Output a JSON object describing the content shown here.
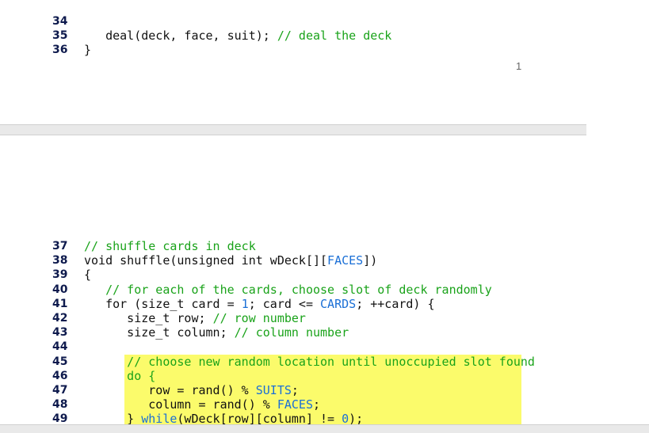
{
  "page1": {
    "page_number": "1",
    "lines": [
      {
        "num": "34",
        "code": "   deal(deck, face, suit); ",
        "comment": "// deal the deck"
      },
      {
        "num": "35",
        "code": "}",
        "comment": ""
      },
      {
        "num": "36",
        "code": "",
        "comment": ""
      }
    ]
  },
  "page2": {
    "lines": [
      {
        "num": "37",
        "segments": [
          {
            "t": "// shuffle cards in deck",
            "c": "cm"
          }
        ]
      },
      {
        "num": "38",
        "segments": [
          {
            "t": "void shuffle(unsigned int wDeck[][",
            "c": ""
          },
          {
            "t": "FACES",
            "c": "kw"
          },
          {
            "t": "])",
            "c": ""
          }
        ]
      },
      {
        "num": "39",
        "segments": [
          {
            "t": "{",
            "c": ""
          }
        ]
      },
      {
        "num": "40",
        "segments": [
          {
            "t": "   // for each of the cards, choose slot of deck randomly",
            "c": "cm"
          }
        ]
      },
      {
        "num": "41",
        "segments": [
          {
            "t": "   for (size_t card = ",
            "c": ""
          },
          {
            "t": "1",
            "c": "num"
          },
          {
            "t": "; card <= ",
            "c": ""
          },
          {
            "t": "CARDS",
            "c": "kw"
          },
          {
            "t": "; ++card) {",
            "c": ""
          }
        ]
      },
      {
        "num": "42",
        "segments": [
          {
            "t": "      size_t row; ",
            "c": ""
          },
          {
            "t": "// row number",
            "c": "cm"
          }
        ]
      },
      {
        "num": "43",
        "segments": [
          {
            "t": "      size_t column; ",
            "c": ""
          },
          {
            "t": "// column number",
            "c": "cm"
          }
        ]
      },
      {
        "num": "44",
        "segments": []
      },
      {
        "num": "45",
        "segments": [
          {
            "t": "      // choose new random location until unoccupied slot found",
            "c": "cm"
          }
        ]
      },
      {
        "num": "46",
        "segments": [
          {
            "t": "      do {",
            "c": "cm"
          }
        ]
      },
      {
        "num": "47",
        "segments": [
          {
            "t": "         row = rand() % ",
            "c": ""
          },
          {
            "t": "SUITS",
            "c": "kw"
          },
          {
            "t": ";",
            "c": ""
          }
        ]
      },
      {
        "num": "48",
        "segments": [
          {
            "t": "         column = rand() % ",
            "c": ""
          },
          {
            "t": "FACES",
            "c": "kw"
          },
          {
            "t": ";",
            "c": ""
          }
        ]
      },
      {
        "num": "49",
        "segments": [
          {
            "t": "      } ",
            "c": ""
          },
          {
            "t": "while",
            "c": "kw"
          },
          {
            "t": "(wDeck[row][column] != ",
            "c": ""
          },
          {
            "t": "0",
            "c": "num"
          },
          {
            "t": ");",
            "c": ""
          }
        ]
      }
    ]
  }
}
